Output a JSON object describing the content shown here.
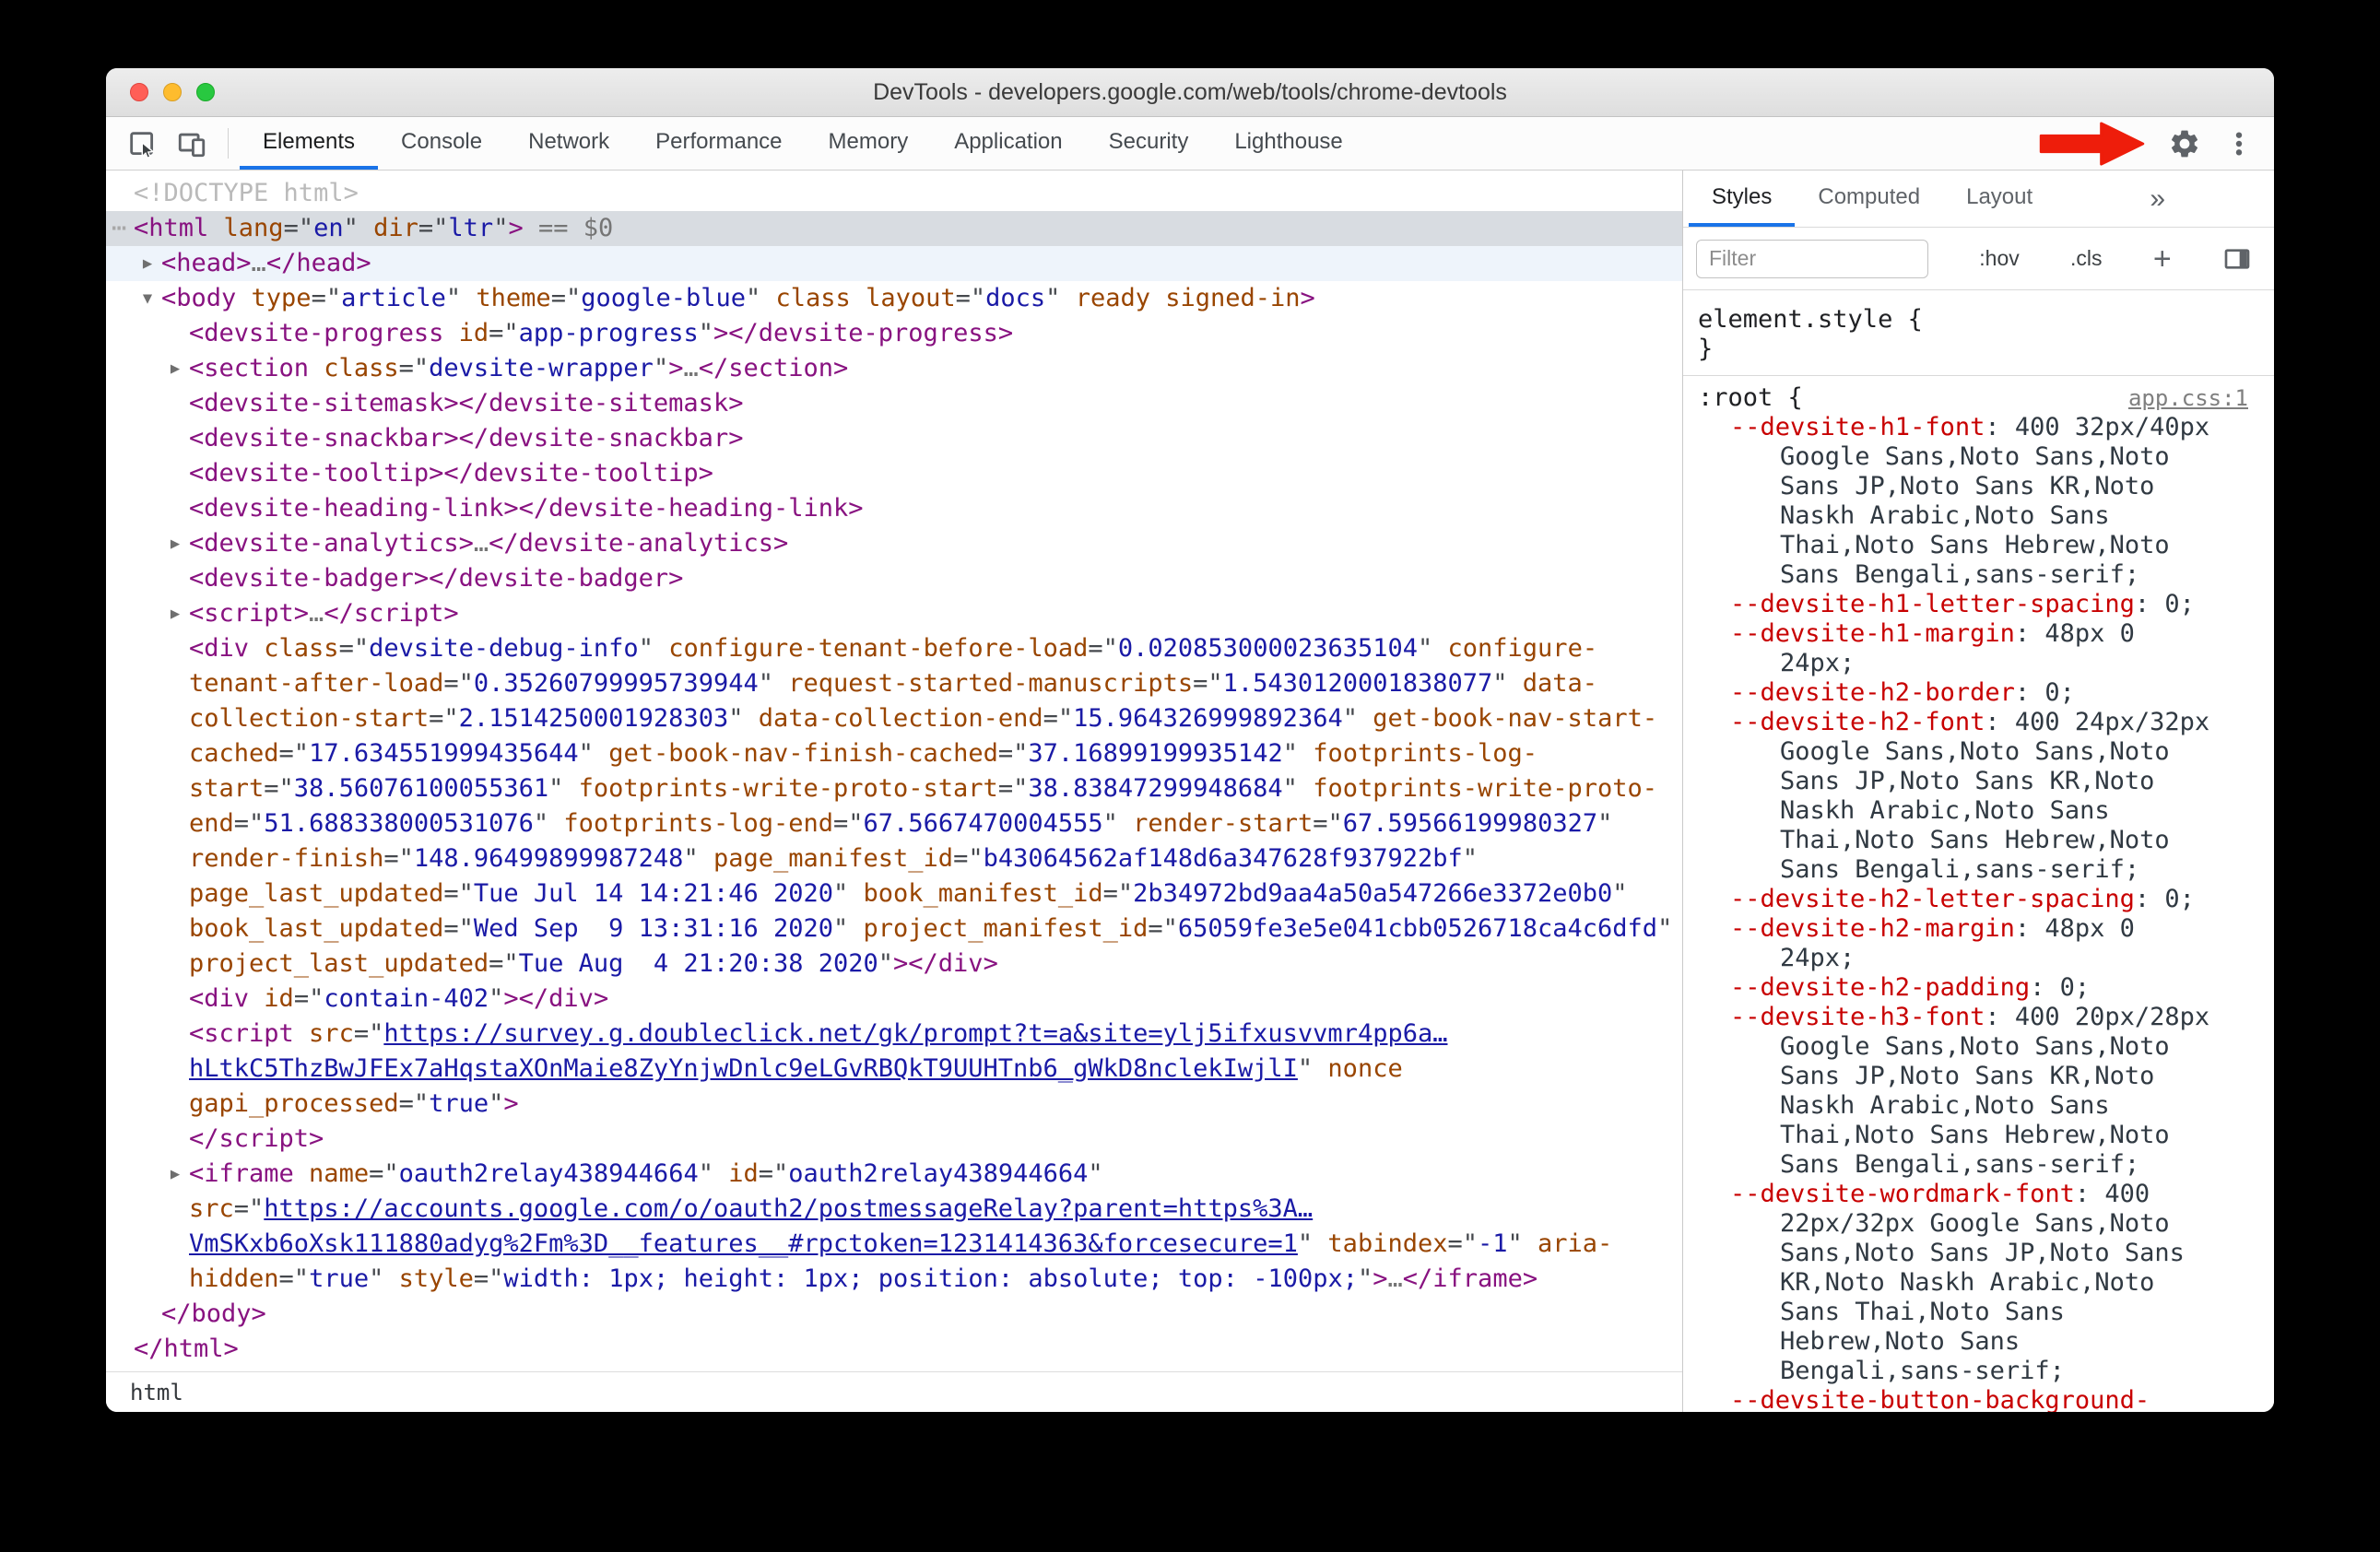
{
  "colors": {
    "accent": "#1a73e8",
    "arrow": "#ee1d0b",
    "tag": "#881280",
    "attr": "#994500",
    "value": "#1a1aa6",
    "propname": "#c80000",
    "doctype": "#bababa",
    "dots": "#757575"
  },
  "window": {
    "title": "DevTools - developers.google.com/web/tools/chrome-devtools"
  },
  "toolbar": {
    "tabs": [
      "Elements",
      "Console",
      "Network",
      "Performance",
      "Memory",
      "Application",
      "Security",
      "Lighthouse"
    ],
    "active_tab": "Elements"
  },
  "breadcrumb": {
    "items": [
      "html"
    ]
  },
  "dom_tree": {
    "lines": [
      {
        "indent": 0,
        "arrow": null,
        "state": null,
        "tokens": [
          [
            "g",
            "<!DOCTYPE html>"
          ]
        ]
      },
      {
        "indent": 0,
        "arrow": null,
        "state": "selected",
        "prefix": "⋯",
        "tokens": [
          [
            "t",
            "<html"
          ],
          [
            "a",
            " lang"
          ],
          [
            "p",
            "=\""
          ],
          [
            "v",
            "en"
          ],
          [
            "p",
            "\""
          ],
          [
            "a",
            " dir"
          ],
          [
            "p",
            "=\""
          ],
          [
            "v",
            "ltr"
          ],
          [
            "p",
            "\""
          ],
          [
            "t",
            ">"
          ],
          [
            "d",
            " == $0"
          ]
        ]
      },
      {
        "indent": 1,
        "arrow": "closed",
        "state": "hover",
        "tokens": [
          [
            "t",
            "<head>"
          ],
          [
            "d",
            "…"
          ],
          [
            "t",
            "</head>"
          ]
        ]
      },
      {
        "indent": 1,
        "arrow": "open",
        "state": null,
        "tokens": [
          [
            "t",
            "<body"
          ],
          [
            "a",
            " type"
          ],
          [
            "p",
            "=\""
          ],
          [
            "v",
            "article"
          ],
          [
            "p",
            "\""
          ],
          [
            "a",
            " theme"
          ],
          [
            "p",
            "=\""
          ],
          [
            "v",
            "google-blue"
          ],
          [
            "p",
            "\""
          ],
          [
            "a",
            " class"
          ],
          [
            "a",
            " layout"
          ],
          [
            "p",
            "=\""
          ],
          [
            "v",
            "docs"
          ],
          [
            "p",
            "\""
          ],
          [
            "a",
            " ready"
          ],
          [
            "a",
            " signed-in"
          ],
          [
            "t",
            ">"
          ]
        ]
      },
      {
        "indent": 2,
        "arrow": null,
        "state": null,
        "tokens": [
          [
            "t",
            "<devsite-progress"
          ],
          [
            "a",
            " id"
          ],
          [
            "p",
            "=\""
          ],
          [
            "v",
            "app-progress"
          ],
          [
            "p",
            "\""
          ],
          [
            "t",
            "></devsite-progress>"
          ]
        ]
      },
      {
        "indent": 2,
        "arrow": "closed",
        "state": null,
        "tokens": [
          [
            "t",
            "<section"
          ],
          [
            "a",
            " class"
          ],
          [
            "p",
            "=\""
          ],
          [
            "v",
            "devsite-wrapper"
          ],
          [
            "p",
            "\""
          ],
          [
            "t",
            ">"
          ],
          [
            "d",
            "…"
          ],
          [
            "t",
            "</section>"
          ]
        ]
      },
      {
        "indent": 2,
        "arrow": null,
        "state": null,
        "tokens": [
          [
            "t",
            "<devsite-sitemask></devsite-sitemask>"
          ]
        ]
      },
      {
        "indent": 2,
        "arrow": null,
        "state": null,
        "tokens": [
          [
            "t",
            "<devsite-snackbar></devsite-snackbar>"
          ]
        ]
      },
      {
        "indent": 2,
        "arrow": null,
        "state": null,
        "tokens": [
          [
            "t",
            "<devsite-tooltip></devsite-tooltip>"
          ]
        ]
      },
      {
        "indent": 2,
        "arrow": null,
        "state": null,
        "tokens": [
          [
            "t",
            "<devsite-heading-link></devsite-heading-link>"
          ]
        ]
      },
      {
        "indent": 2,
        "arrow": "closed",
        "state": null,
        "tokens": [
          [
            "t",
            "<devsite-analytics>"
          ],
          [
            "d",
            "…"
          ],
          [
            "t",
            "</devsite-analytics>"
          ]
        ]
      },
      {
        "indent": 2,
        "arrow": null,
        "state": null,
        "tokens": [
          [
            "t",
            "<devsite-badger></devsite-badger>"
          ]
        ]
      },
      {
        "indent": 2,
        "arrow": "closed",
        "state": null,
        "tokens": [
          [
            "t",
            "<script>"
          ],
          [
            "d",
            "…"
          ],
          [
            "t",
            "</script>"
          ]
        ]
      },
      {
        "indent": 2,
        "arrow": null,
        "state": null,
        "tokens": [
          [
            "t",
            "<div"
          ],
          [
            "a",
            " class"
          ],
          [
            "p",
            "=\""
          ],
          [
            "v",
            "devsite-debug-info"
          ],
          [
            "p",
            "\""
          ],
          [
            "a",
            " configure-tenant-before-load"
          ],
          [
            "p",
            "=\""
          ],
          [
            "v",
            "0.020853000023635104"
          ],
          [
            "p",
            "\""
          ],
          [
            "a",
            " configure-tenant-after-load"
          ],
          [
            "p",
            "=\""
          ],
          [
            "v",
            "0.35260799995739944"
          ],
          [
            "p",
            "\""
          ],
          [
            "a",
            " request-started-manuscripts"
          ],
          [
            "p",
            "=\""
          ],
          [
            "v",
            "1.5430120001838077"
          ],
          [
            "p",
            "\""
          ],
          [
            "a",
            " data-collection-start"
          ],
          [
            "p",
            "=\""
          ],
          [
            "v",
            "2.1514250001928303"
          ],
          [
            "p",
            "\""
          ],
          [
            "a",
            " data-collection-end"
          ],
          [
            "p",
            "=\""
          ],
          [
            "v",
            "15.964326999892364"
          ],
          [
            "p",
            "\""
          ],
          [
            "a",
            " get-book-nav-start-cached"
          ],
          [
            "p",
            "=\""
          ],
          [
            "v",
            "17.634551999435644"
          ],
          [
            "p",
            "\""
          ],
          [
            "a",
            " get-book-nav-finish-cached"
          ],
          [
            "p",
            "=\""
          ],
          [
            "v",
            "37.16899199935142"
          ],
          [
            "p",
            "\""
          ],
          [
            "a",
            " footprints-log-start"
          ],
          [
            "p",
            "=\""
          ],
          [
            "v",
            "38.56076100055361"
          ],
          [
            "p",
            "\""
          ],
          [
            "a",
            " footprints-write-proto-start"
          ],
          [
            "p",
            "=\""
          ],
          [
            "v",
            "38.83847299948684"
          ],
          [
            "p",
            "\""
          ],
          [
            "a",
            " footprints-write-proto-end"
          ],
          [
            "p",
            "=\""
          ],
          [
            "v",
            "51.688338000531076"
          ],
          [
            "p",
            "\""
          ],
          [
            "a",
            " footprints-log-end"
          ],
          [
            "p",
            "=\""
          ],
          [
            "v",
            "67.5667470004555"
          ],
          [
            "p",
            "\""
          ],
          [
            "a",
            " render-start"
          ],
          [
            "p",
            "=\""
          ],
          [
            "v",
            "67.59566199980327"
          ],
          [
            "p",
            "\""
          ],
          [
            "a",
            " render-finish"
          ],
          [
            "p",
            "=\""
          ],
          [
            "v",
            "148.96499899987248"
          ],
          [
            "p",
            "\""
          ],
          [
            "a",
            " page_manifest_id"
          ],
          [
            "p",
            "=\""
          ],
          [
            "v",
            "b43064562af148d6a347628f937922bf"
          ],
          [
            "p",
            "\""
          ],
          [
            "a",
            " page_last_updated"
          ],
          [
            "p",
            "=\""
          ],
          [
            "v",
            "Tue Jul 14 14:21:46 2020"
          ],
          [
            "p",
            "\""
          ],
          [
            "a",
            " book_manifest_id"
          ],
          [
            "p",
            "=\""
          ],
          [
            "v",
            "2b34972bd9aa4a50a547266e3372e0b0"
          ],
          [
            "p",
            "\""
          ],
          [
            "a",
            " book_last_updated"
          ],
          [
            "p",
            "=\""
          ],
          [
            "v",
            "Wed Sep  9 13:31:16 2020"
          ],
          [
            "p",
            "\""
          ],
          [
            "a",
            " project_manifest_id"
          ],
          [
            "p",
            "=\""
          ],
          [
            "v",
            "65059fe3e5e041cbb0526718ca4c6dfd"
          ],
          [
            "p",
            "\""
          ],
          [
            "a",
            " project_last_updated"
          ],
          [
            "p",
            "=\""
          ],
          [
            "v",
            "Tue Aug  4 21:20:38 2020"
          ],
          [
            "p",
            "\""
          ],
          [
            "t",
            "></div>"
          ]
        ]
      },
      {
        "indent": 2,
        "arrow": null,
        "state": null,
        "tokens": [
          [
            "t",
            "<div"
          ],
          [
            "a",
            " id"
          ],
          [
            "p",
            "=\""
          ],
          [
            "v",
            "contain-402"
          ],
          [
            "p",
            "\""
          ],
          [
            "t",
            "></div>"
          ]
        ]
      },
      {
        "indent": 2,
        "arrow": null,
        "state": null,
        "tokens": [
          [
            "t",
            "<script"
          ],
          [
            "a",
            " src"
          ],
          [
            "p",
            "=\""
          ],
          [
            "l",
            "https://survey.g.doubleclick.net/gk/prompt?t=a&site=ylj5ifxusvvmr4pp6a…hLtkC5ThzBwJFEx7aHqstaXOnMaie8ZyYnjwDnlc9eLGvRBQkT9UUHTnb6_gWkD8nclekIwjlI"
          ],
          [
            "p",
            "\""
          ],
          [
            "a",
            " nonce"
          ],
          [
            "a",
            " gapi_processed"
          ],
          [
            "p",
            "=\""
          ],
          [
            "v",
            "true"
          ],
          [
            "p",
            "\""
          ],
          [
            "t",
            ">"
          ]
        ]
      },
      {
        "indent": 2,
        "arrow": null,
        "state": null,
        "tokens": [
          [
            "t",
            "</script>"
          ]
        ]
      },
      {
        "indent": 2,
        "arrow": "closed",
        "state": null,
        "tokens": [
          [
            "t",
            "<iframe"
          ],
          [
            "a",
            " name"
          ],
          [
            "p",
            "=\""
          ],
          [
            "v",
            "oauth2relay438944664"
          ],
          [
            "p",
            "\""
          ],
          [
            "a",
            " id"
          ],
          [
            "p",
            "=\""
          ],
          [
            "v",
            "oauth2relay438944664"
          ],
          [
            "p",
            "\""
          ],
          [
            "a",
            " src"
          ],
          [
            "p",
            "=\""
          ],
          [
            "l",
            "https://accounts.google.com/o/oauth2/postmessageRelay?parent=https%3A…VmSKxb6oXsk111880adyg%2Fm%3D__features__#rpctoken=1231414363&forcesecure=1"
          ],
          [
            "p",
            "\""
          ],
          [
            "a",
            " tabindex"
          ],
          [
            "p",
            "=\""
          ],
          [
            "v",
            "-1"
          ],
          [
            "p",
            "\""
          ],
          [
            "a",
            " aria-hidden"
          ],
          [
            "p",
            "=\""
          ],
          [
            "v",
            "true"
          ],
          [
            "p",
            "\""
          ],
          [
            "a",
            " style"
          ],
          [
            "p",
            "=\""
          ],
          [
            "v",
            "width: 1px; height: 1px; position: absolute; top: -100px;"
          ],
          [
            "p",
            "\""
          ],
          [
            "t",
            ">"
          ],
          [
            "d",
            "…"
          ],
          [
            "t",
            "</iframe>"
          ]
        ]
      },
      {
        "indent": 1,
        "arrow": null,
        "state": null,
        "tokens": [
          [
            "t",
            "</body>"
          ]
        ]
      },
      {
        "indent": 0,
        "arrow": null,
        "state": null,
        "tokens": [
          [
            "t",
            "</html>"
          ]
        ]
      }
    ]
  },
  "styles_panel": {
    "tabs": [
      "Styles",
      "Computed",
      "Layout"
    ],
    "active_tab": "Styles",
    "overflow_symbol": "»",
    "filter_placeholder": "Filter",
    "hov_label": ":hov",
    "cls_label": ".cls",
    "add_label": "+",
    "rules": [
      {
        "selector": "element.style",
        "source": null,
        "props": []
      },
      {
        "selector": ":root",
        "source": "app.css:1",
        "props": [
          {
            "name": "--devsite-h1-font",
            "value": "400 32px/40px Google Sans,Noto Sans,Noto Sans JP,Noto Sans KR,Noto Naskh Arabic,Noto Sans Thai,Noto Sans Hebrew,Noto Sans Bengali,sans-serif;"
          },
          {
            "name": "--devsite-h1-letter-spacing",
            "value": "0;"
          },
          {
            "name": "--devsite-h1-margin",
            "value": "48px 0 24px;"
          },
          {
            "name": "--devsite-h2-border",
            "value": "0;"
          },
          {
            "name": "--devsite-h2-font",
            "value": "400 24px/32px Google Sans,Noto Sans,Noto Sans JP,Noto Sans KR,Noto Naskh Arabic,Noto Sans Thai,Noto Sans Hebrew,Noto Sans Bengali,sans-serif;"
          },
          {
            "name": "--devsite-h2-letter-spacing",
            "value": "0;"
          },
          {
            "name": "--devsite-h2-margin",
            "value": "48px 0 24px;"
          },
          {
            "name": "--devsite-h2-padding",
            "value": "0;"
          },
          {
            "name": "--devsite-h3-font",
            "value": "400 20px/28px Google Sans,Noto Sans,Noto Sans JP,Noto Sans KR,Noto Naskh Arabic,Noto Sans Thai,Noto Sans Hebrew,Noto Sans Bengali,sans-serif;"
          },
          {
            "name": "--devsite-wordmark-font",
            "value": "400 22px/32px Google Sans,Noto Sans,Noto Sans JP,Noto Sans KR,Noto Naskh Arabic,Noto Sans Thai,Noto Sans Hebrew,Noto Sans Bengali,sans-serif;"
          },
          {
            "name": "--devsite-button-background-hover",
            "value": null
          }
        ]
      }
    ]
  }
}
